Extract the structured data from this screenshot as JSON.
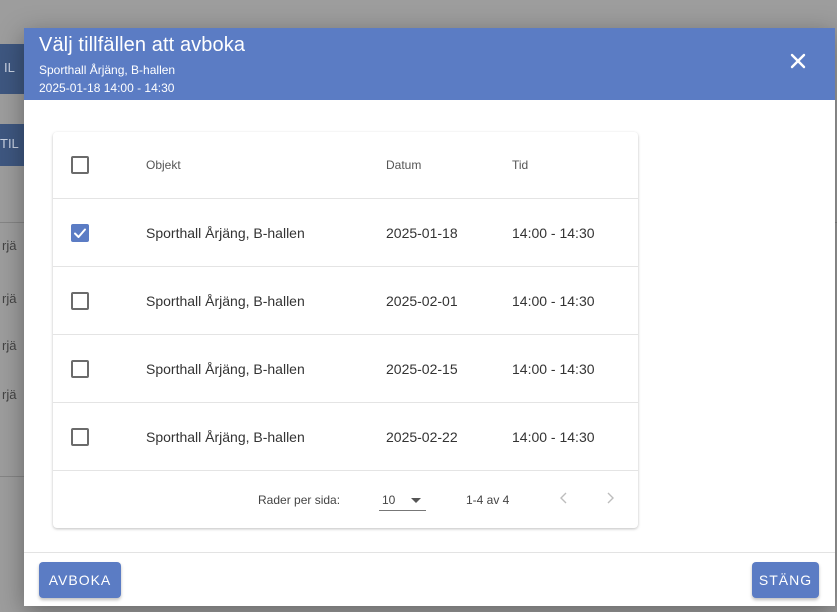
{
  "background": {
    "row_fragments": [
      "rjä",
      "rjä",
      "rjä",
      "rjä"
    ],
    "top_label_fragments": [
      "IL",
      "TIL"
    ]
  },
  "dialog": {
    "title": "Välj tillfällen att avboka",
    "subtitle_location": "Sporthall Årjäng, B-hallen",
    "subtitle_time": "2025-01-18 14:00 - 14:30",
    "close_icon": "close-icon"
  },
  "table": {
    "headers": {
      "object": "Objekt",
      "date": "Datum",
      "time": "Tid"
    },
    "rows": [
      {
        "checked": true,
        "object": "Sporthall Årjäng, B-hallen",
        "date": "2025-01-18",
        "time": "14:00 - 14:30"
      },
      {
        "checked": false,
        "object": "Sporthall Årjäng, B-hallen",
        "date": "2025-02-01",
        "time": "14:00 - 14:30"
      },
      {
        "checked": false,
        "object": "Sporthall Årjäng, B-hallen",
        "date": "2025-02-15",
        "time": "14:00 - 14:30"
      },
      {
        "checked": false,
        "object": "Sporthall Årjäng, B-hallen",
        "date": "2025-02-22",
        "time": "14:00 - 14:30"
      }
    ],
    "footer": {
      "rows_per_page_label": "Rader per sida:",
      "rows_per_page_value": "10",
      "range": "1-4 av 4",
      "prev_icon": "chevron-left-icon",
      "next_icon": "chevron-right-icon"
    }
  },
  "actions": {
    "cancel_booking_label": "AVBOKA",
    "close_label": "STÄNG"
  },
  "colors": {
    "primary": "#5b7cc4",
    "overlay": "#9d9d9d"
  }
}
